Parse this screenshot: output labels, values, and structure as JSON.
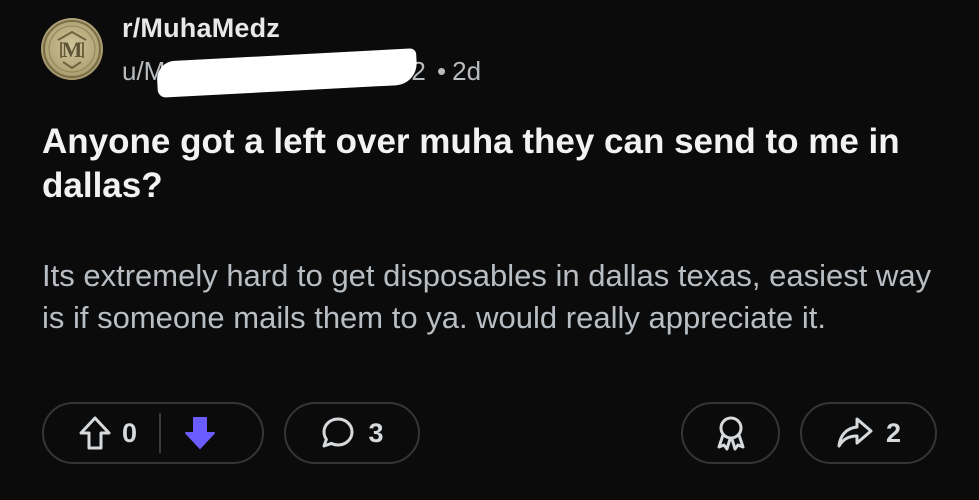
{
  "post": {
    "subreddit": "r/MuhaMedz",
    "author_prefix": "u/M",
    "author_suffix": "2",
    "separator": "•",
    "age": "2d",
    "title": "Anyone got a left over muha they can send to me in dallas?",
    "body": "Its extremely hard to get disposables in dallas texas, easiest way is if someone mails them to ya. would really appreciate it."
  },
  "actions": {
    "vote_count": "0",
    "comment_count": "3",
    "share_count": "2"
  },
  "avatar": {
    "monogram": "M"
  },
  "colors": {
    "background": "#0b0b0c",
    "downvote_active": "#6a5cff",
    "pill_border": "#343536",
    "avatar_gold": "#b3a677"
  },
  "icons": {
    "upvote": "arrow-up-outline-icon",
    "downvote": "arrow-down-filled-icon",
    "comment": "speech-bubble-icon",
    "award": "award-ribbon-icon",
    "share": "share-arrow-icon"
  }
}
